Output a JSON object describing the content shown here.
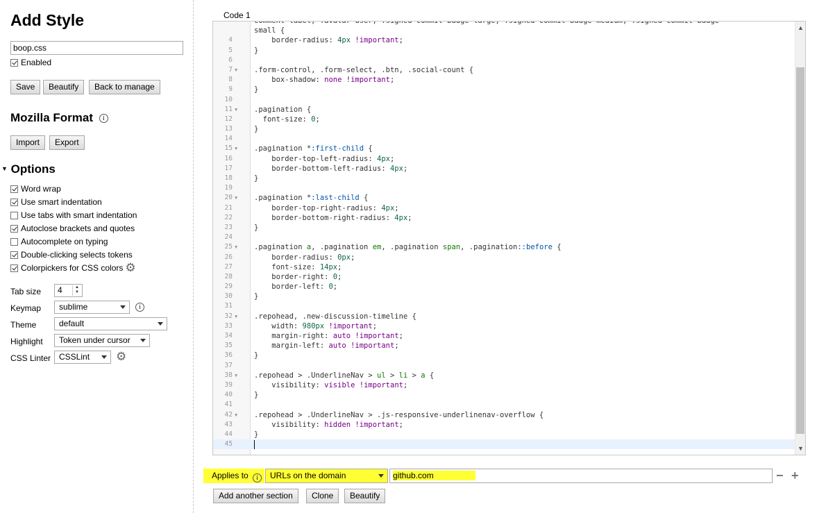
{
  "title": "Add Style",
  "style_name": "boop.css",
  "enabled_label": "Enabled",
  "buttons": {
    "save": "Save",
    "beautify": "Beautify",
    "back": "Back to manage"
  },
  "mozilla": {
    "heading": "Mozilla Format",
    "import": "Import",
    "export": "Export"
  },
  "options": {
    "heading": "Options",
    "checkboxes": [
      {
        "label": "Word wrap",
        "checked": true
      },
      {
        "label": "Use smart indentation",
        "checked": true
      },
      {
        "label": "Use tabs with smart indentation",
        "checked": false
      },
      {
        "label": "Autoclose brackets and quotes",
        "checked": true
      },
      {
        "label": "Autocomplete on typing",
        "checked": false
      },
      {
        "label": "Double-clicking selects tokens",
        "checked": true
      },
      {
        "label": "Colorpickers for CSS colors",
        "checked": true
      }
    ],
    "tab_size_label": "Tab size",
    "tab_size": "4",
    "keymap_label": "Keymap",
    "keymap": "sublime",
    "theme_label": "Theme",
    "theme": "default",
    "highlight_label": "Highlight",
    "highlight": "Token under cursor",
    "linter_label": "CSS Linter",
    "linter": "CSSLint"
  },
  "section": {
    "label": "Code 1",
    "lines": [
      {
        "n": "",
        "fold": false,
        "tokens": [
          [
            "sel",
            "comment-label, .avatar-user, .signed-commit-badge-large, .signed-commit-badge-medium, .signed-commit-badge-"
          ]
        ]
      },
      {
        "n": "",
        "fold": false,
        "tokens": [
          [
            "sel",
            "small {"
          ]
        ]
      },
      {
        "n": "4",
        "fold": false,
        "tokens": [
          [
            "sel",
            "    border-radius: "
          ],
          [
            "num",
            "4px"
          ],
          [
            "sel",
            " "
          ],
          [
            "imp",
            "!important"
          ],
          [
            "sel",
            ";"
          ]
        ]
      },
      {
        "n": "5",
        "fold": false,
        "tokens": [
          [
            "sel",
            "}"
          ]
        ]
      },
      {
        "n": "6",
        "fold": false,
        "tokens": []
      },
      {
        "n": "7",
        "fold": true,
        "tokens": [
          [
            "sel",
            ".form-control, .form-select, .btn, .social-count {"
          ]
        ]
      },
      {
        "n": "8",
        "fold": false,
        "tokens": [
          [
            "sel",
            "    box-shadow: "
          ],
          [
            "kw",
            "none"
          ],
          [
            "sel",
            " "
          ],
          [
            "imp",
            "!important"
          ],
          [
            "sel",
            ";"
          ]
        ]
      },
      {
        "n": "9",
        "fold": false,
        "tokens": [
          [
            "sel",
            "}"
          ]
        ]
      },
      {
        "n": "10",
        "fold": false,
        "tokens": []
      },
      {
        "n": "11",
        "fold": true,
        "tokens": [
          [
            "sel",
            ".pagination {"
          ]
        ]
      },
      {
        "n": "12",
        "fold": false,
        "tokens": [
          [
            "sel",
            "  font-size: "
          ],
          [
            "num",
            "0"
          ],
          [
            "sel",
            ";"
          ]
        ]
      },
      {
        "n": "13",
        "fold": false,
        "tokens": [
          [
            "sel",
            "}"
          ]
        ]
      },
      {
        "n": "14",
        "fold": false,
        "tokens": []
      },
      {
        "n": "15",
        "fold": true,
        "tokens": [
          [
            "sel",
            ".pagination *"
          ],
          [
            "pseudo",
            ":first-child"
          ],
          [
            "sel",
            " {"
          ]
        ]
      },
      {
        "n": "16",
        "fold": false,
        "tokens": [
          [
            "sel",
            "    border-top-left-radius: "
          ],
          [
            "num",
            "4px"
          ],
          [
            "sel",
            ";"
          ]
        ]
      },
      {
        "n": "17",
        "fold": false,
        "tokens": [
          [
            "sel",
            "    border-bottom-left-radius: "
          ],
          [
            "num",
            "4px"
          ],
          [
            "sel",
            ";"
          ]
        ]
      },
      {
        "n": "18",
        "fold": false,
        "tokens": [
          [
            "sel",
            "}"
          ]
        ]
      },
      {
        "n": "19",
        "fold": false,
        "tokens": []
      },
      {
        "n": "20",
        "fold": true,
        "tokens": [
          [
            "sel",
            ".pagination *"
          ],
          [
            "pseudo",
            ":last-child"
          ],
          [
            "sel",
            " {"
          ]
        ]
      },
      {
        "n": "21",
        "fold": false,
        "tokens": [
          [
            "sel",
            "    border-top-right-radius: "
          ],
          [
            "num",
            "4px"
          ],
          [
            "sel",
            ";"
          ]
        ]
      },
      {
        "n": "22",
        "fold": false,
        "tokens": [
          [
            "sel",
            "    border-bottom-right-radius: "
          ],
          [
            "num",
            "4px"
          ],
          [
            "sel",
            ";"
          ]
        ]
      },
      {
        "n": "23",
        "fold": false,
        "tokens": [
          [
            "sel",
            "}"
          ]
        ]
      },
      {
        "n": "24",
        "fold": false,
        "tokens": []
      },
      {
        "n": "25",
        "fold": true,
        "tokens": [
          [
            "sel",
            ".pagination "
          ],
          [
            "tag",
            "a"
          ],
          [
            "sel",
            ", .pagination "
          ],
          [
            "tag",
            "em"
          ],
          [
            "sel",
            ", .pagination "
          ],
          [
            "tag",
            "span"
          ],
          [
            "sel",
            ", .pagination"
          ],
          [
            "pseudo",
            "::before"
          ],
          [
            "sel",
            " {"
          ]
        ]
      },
      {
        "n": "26",
        "fold": false,
        "tokens": [
          [
            "sel",
            "    border-radius: "
          ],
          [
            "num",
            "0px"
          ],
          [
            "sel",
            ";"
          ]
        ]
      },
      {
        "n": "27",
        "fold": false,
        "tokens": [
          [
            "sel",
            "    font-size: "
          ],
          [
            "num",
            "14px"
          ],
          [
            "sel",
            ";"
          ]
        ]
      },
      {
        "n": "28",
        "fold": false,
        "tokens": [
          [
            "sel",
            "    border-right: "
          ],
          [
            "num",
            "0"
          ],
          [
            "sel",
            ";"
          ]
        ]
      },
      {
        "n": "29",
        "fold": false,
        "tokens": [
          [
            "sel",
            "    border-left: "
          ],
          [
            "num",
            "0"
          ],
          [
            "sel",
            ";"
          ]
        ]
      },
      {
        "n": "30",
        "fold": false,
        "tokens": [
          [
            "sel",
            "}"
          ]
        ]
      },
      {
        "n": "31",
        "fold": false,
        "tokens": []
      },
      {
        "n": "32",
        "fold": true,
        "tokens": [
          [
            "sel",
            ".repohead, .new-discussion-timeline {"
          ]
        ]
      },
      {
        "n": "33",
        "fold": false,
        "tokens": [
          [
            "sel",
            "    width: "
          ],
          [
            "num",
            "980px"
          ],
          [
            "sel",
            " "
          ],
          [
            "imp",
            "!important"
          ],
          [
            "sel",
            ";"
          ]
        ]
      },
      {
        "n": "34",
        "fold": false,
        "tokens": [
          [
            "sel",
            "    margin-right: "
          ],
          [
            "kw",
            "auto"
          ],
          [
            "sel",
            " "
          ],
          [
            "imp",
            "!important"
          ],
          [
            "sel",
            ";"
          ]
        ]
      },
      {
        "n": "35",
        "fold": false,
        "tokens": [
          [
            "sel",
            "    margin-left: "
          ],
          [
            "kw",
            "auto"
          ],
          [
            "sel",
            " "
          ],
          [
            "imp",
            "!important"
          ],
          [
            "sel",
            ";"
          ]
        ]
      },
      {
        "n": "36",
        "fold": false,
        "tokens": [
          [
            "sel",
            "}"
          ]
        ]
      },
      {
        "n": "37",
        "fold": false,
        "tokens": []
      },
      {
        "n": "38",
        "fold": true,
        "tokens": [
          [
            "sel",
            ".repohead > .UnderlineNav > "
          ],
          [
            "tag",
            "ul"
          ],
          [
            "sel",
            " > "
          ],
          [
            "tag",
            "li"
          ],
          [
            "sel",
            " > "
          ],
          [
            "tag",
            "a"
          ],
          [
            "sel",
            " {"
          ]
        ]
      },
      {
        "n": "39",
        "fold": false,
        "tokens": [
          [
            "sel",
            "    visibility: "
          ],
          [
            "kw",
            "visible"
          ],
          [
            "sel",
            " "
          ],
          [
            "imp",
            "!important"
          ],
          [
            "sel",
            ";"
          ]
        ]
      },
      {
        "n": "40",
        "fold": false,
        "tokens": [
          [
            "sel",
            "}"
          ]
        ]
      },
      {
        "n": "41",
        "fold": false,
        "tokens": []
      },
      {
        "n": "42",
        "fold": true,
        "tokens": [
          [
            "sel",
            ".repohead > .UnderlineNav > .js-responsive-underlinenav-overflow {"
          ]
        ]
      },
      {
        "n": "43",
        "fold": false,
        "tokens": [
          [
            "sel",
            "    visibility: "
          ],
          [
            "kw",
            "hidden"
          ],
          [
            "sel",
            " "
          ],
          [
            "imp",
            "!important"
          ],
          [
            "sel",
            ";"
          ]
        ]
      },
      {
        "n": "44",
        "fold": false,
        "tokens": [
          [
            "sel",
            "}"
          ]
        ]
      },
      {
        "n": "45",
        "fold": false,
        "tokens": [],
        "active": true
      }
    ],
    "applies_label": "Applies to",
    "applies_type": "URLs on the domain",
    "applies_value": "github.com",
    "add_section": "Add another section",
    "clone": "Clone",
    "beautify": "Beautify"
  },
  "colors": {
    "highlight": "#ffff33",
    "number": "#116644",
    "important": "#770088"
  }
}
